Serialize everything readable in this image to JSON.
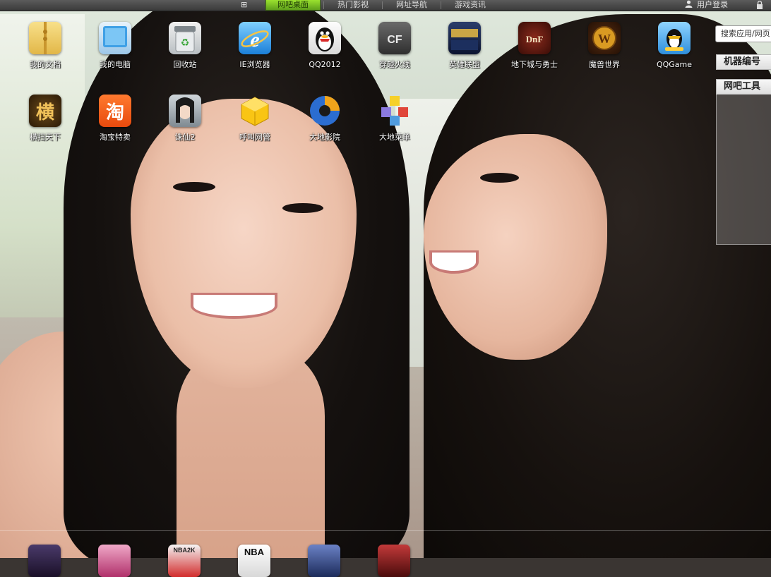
{
  "taskbar": {
    "tabs": [
      {
        "label": "网吧桌面",
        "active": true
      },
      {
        "label": "热门影视",
        "active": false
      },
      {
        "label": "网址导航",
        "active": false
      },
      {
        "label": "游戏资讯",
        "active": false
      }
    ],
    "login_label": "用户登录",
    "accent_color": "#7cc224"
  },
  "desktop": {
    "row1": [
      {
        "label": "我的文档",
        "icon": "folder-icon"
      },
      {
        "label": "我的电脑",
        "icon": "computer-icon"
      },
      {
        "label": "回收站",
        "icon": "recycle-bin-icon"
      },
      {
        "label": "IE浏览器",
        "icon": "ie-browser-icon"
      },
      {
        "label": "QQ2012",
        "icon": "qq-penguin-icon"
      },
      {
        "label": "穿越火线",
        "icon": "crossfire-icon"
      },
      {
        "label": "英雄联盟",
        "icon": "league-of-legends-icon"
      },
      {
        "label": "地下城与勇士",
        "icon": "dnf-icon"
      },
      {
        "label": "魔兽世界",
        "icon": "world-of-warcraft-icon"
      },
      {
        "label": "QQGame",
        "icon": "qqgame-icon"
      }
    ],
    "row2": [
      {
        "label": "横扫天下",
        "icon": "hengsao-icon",
        "glyph": "横"
      },
      {
        "label": "淘宝特卖",
        "icon": "taobao-icon",
        "glyph": "淘"
      },
      {
        "label": "诛仙2",
        "icon": "zhuxian-icon"
      },
      {
        "label": "呼叫网管",
        "icon": "call-admin-icon"
      },
      {
        "label": "大地影院",
        "icon": "dadi-cinema-icon"
      },
      {
        "label": "大地菜单",
        "icon": "dadi-menu-icon"
      }
    ],
    "dock": [
      {
        "icon": "dock-game-icon-1",
        "text": ""
      },
      {
        "icon": "dock-game-icon-2",
        "text": ""
      },
      {
        "icon": "nba2k-icon",
        "text": "NBA2K"
      },
      {
        "icon": "nba-icon",
        "text": "NBA"
      },
      {
        "icon": "dock-game-icon-5",
        "text": ""
      },
      {
        "icon": "dock-game-icon-6",
        "text": ""
      }
    ]
  },
  "sidebar": {
    "search_placeholder": "搜索应用/网页",
    "machine_label": "机器编号",
    "tools_label": "网吧工具"
  }
}
